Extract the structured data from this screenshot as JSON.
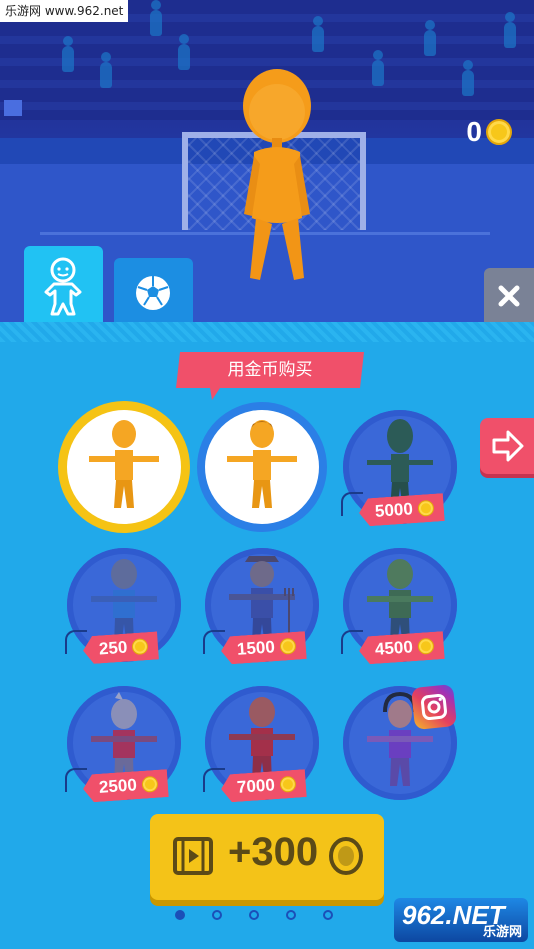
{
  "watermark_top": "乐游网 www.962.net",
  "watermark_bottom": {
    "logo": "962.NET",
    "name": "乐游网"
  },
  "coin_balance": "0",
  "tabs": [
    {
      "name": "character",
      "icon": "character-icon"
    },
    {
      "name": "ball",
      "icon": "soccer-ball-icon"
    }
  ],
  "close_icon": "close-icon",
  "banner": {
    "label": "用金币购买"
  },
  "next_icon": "arrow-right-icon",
  "characters": [
    {
      "state": "selected",
      "price": ""
    },
    {
      "state": "owned",
      "price": ""
    },
    {
      "state": "locked",
      "price": "5000"
    },
    {
      "state": "locked",
      "price": "250"
    },
    {
      "state": "locked",
      "price": "1500"
    },
    {
      "state": "locked",
      "price": "4500"
    },
    {
      "state": "locked",
      "price": "2500"
    },
    {
      "state": "locked",
      "price": "7000"
    },
    {
      "state": "locked-social",
      "price": "",
      "badge": "instagram-icon"
    }
  ],
  "video_reward": {
    "label": "+300",
    "icon": "video-icon"
  },
  "pagination": {
    "pages": 5,
    "current": 1
  },
  "colors": {
    "panel": "#21a9ea",
    "price_tag": "#f0506a",
    "gold": "#f4c318",
    "selected_ring": "#f5c314"
  }
}
